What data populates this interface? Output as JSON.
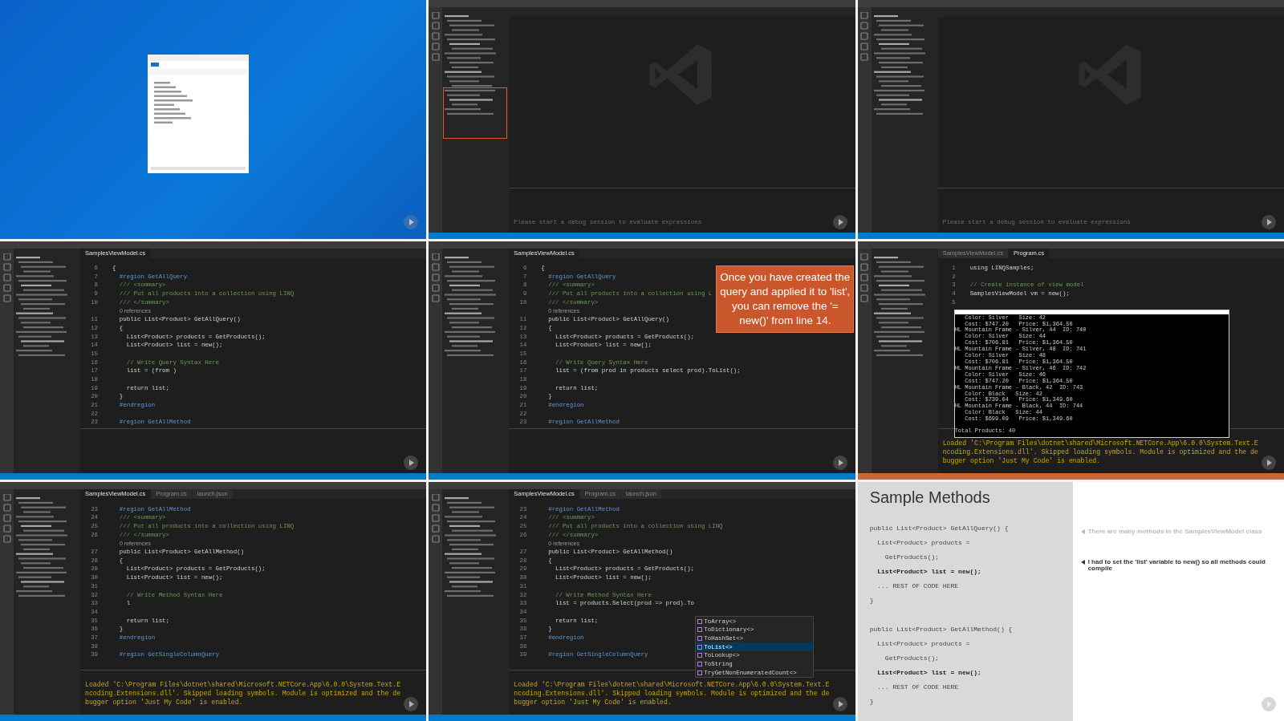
{
  "tiles": [
    {
      "kind": "desktop"
    },
    {
      "kind": "vscode",
      "welcome": true,
      "debugging": false,
      "sidebar_highlight": true,
      "panel_text": "Please start a debug session to evaluate expressions"
    },
    {
      "kind": "vscode",
      "welcome": true,
      "debugging": false,
      "panel_text": "Please start a debug session to evaluate expressions"
    },
    {
      "kind": "vscode",
      "debugging": false,
      "tabs": [
        {
          "label": "SamplesViewModel.cs",
          "selected": true
        }
      ],
      "lines": [
        {
          "num": "6",
          "text": "{",
          "kind": "code"
        },
        {
          "num": "7",
          "text": "  #region GetAllQuery",
          "kind": "region"
        },
        {
          "num": "8",
          "text": "  /// <summary>",
          "kind": "doc"
        },
        {
          "num": "9",
          "text": "  /// Put all products into a collection using LINQ",
          "kind": "doc"
        },
        {
          "num": "10",
          "text": "  /// </summary>",
          "kind": "doc"
        },
        {
          "text": "0 references",
          "kind": "refs"
        },
        {
          "num": "11",
          "text": "  public List<Product> GetAllQuery()",
          "kind": "code"
        },
        {
          "num": "12",
          "text": "  {",
          "kind": "code"
        },
        {
          "num": "13",
          "text": "    List<Product> products = GetProducts();",
          "kind": "code"
        },
        {
          "num": "14",
          "text": "    List<Product> list = new();",
          "kind": "code"
        },
        {
          "num": "15"
        },
        {
          "num": "16",
          "text": "    // Write Query Syntax Here",
          "kind": "comment"
        },
        {
          "num": "17",
          "text": "    list = (from )",
          "kind": "code"
        },
        {
          "num": "18"
        },
        {
          "num": "19",
          "text": "    return list;",
          "kind": "code"
        },
        {
          "num": "20",
          "text": "  }",
          "kind": "code"
        },
        {
          "num": "21",
          "text": "  #endregion",
          "kind": "region"
        },
        {
          "num": "22"
        },
        {
          "num": "23",
          "text": "  #region GetAllMethod",
          "kind": "region"
        }
      ]
    },
    {
      "kind": "vscode",
      "debugging": false,
      "tabs": [
        {
          "label": "SamplesViewModel.cs",
          "selected": true
        }
      ],
      "overlay_note": "Once you have created the query and applied it to 'list', you can remove the '= new()' from line 14.",
      "lines": [
        {
          "num": "6",
          "text": "{",
          "kind": "code"
        },
        {
          "num": "7",
          "text": "  #region GetAllQuery",
          "kind": "region"
        },
        {
          "num": "8",
          "text": "  /// <summary>",
          "kind": "doc"
        },
        {
          "num": "9",
          "text": "  /// Put all products into a collection using L",
          "kind": "doc"
        },
        {
          "num": "10",
          "text": "  /// </summary>",
          "kind": "doc"
        },
        {
          "text": "0 references",
          "kind": "refs"
        },
        {
          "num": "11",
          "text": "  public List<Product> GetAllQuery()",
          "kind": "code"
        },
        {
          "num": "12",
          "text": "  {",
          "kind": "code"
        },
        {
          "num": "13",
          "text": "    List<Product> products = GetProducts();",
          "kind": "code"
        },
        {
          "num": "14",
          "text": "    List<Product> list = new();",
          "kind": "code"
        },
        {
          "num": "15"
        },
        {
          "num": "16",
          "text": "    // Write Query Syntax Here",
          "kind": "comment"
        },
        {
          "num": "17",
          "text": "    list = (from prod in products select prod).ToList();",
          "kind": "code"
        },
        {
          "num": "18"
        },
        {
          "num": "19",
          "text": "    return list;",
          "kind": "code"
        },
        {
          "num": "20",
          "text": "  }",
          "kind": "code"
        },
        {
          "num": "21",
          "text": "  #endregion",
          "kind": "region"
        },
        {
          "num": "22"
        },
        {
          "num": "23",
          "text": "  #region GetAllMethod",
          "kind": "region"
        }
      ]
    },
    {
      "kind": "vscode",
      "debugging": true,
      "tabs": [
        {
          "label": "SamplesViewModel.cs",
          "selected": false
        },
        {
          "label": "Program.cs",
          "selected": true
        }
      ],
      "lines": [
        {
          "num": "1",
          "text": "using LINQSamples;",
          "kind": "code"
        },
        {
          "num": "2"
        },
        {
          "num": "3",
          "text": "// Create instance of view model",
          "kind": "comment"
        },
        {
          "num": "4",
          "text": "SamplesViewModel vm = new();",
          "kind": "code"
        },
        {
          "num": "5"
        }
      ],
      "console_window": {
        "lines": [
          "   Color: Silver   Size: 42",
          "   Cost: $747.20   Price: $1,364.50",
          "HL Mountain Frame - Silver, 44  ID: 740",
          "   Color: Silver   Size: 44",
          "   Cost: $706.81   Price: $1,364.50",
          "HL Mountain Frame - Silver, 48  ID: 741",
          "   Color: Silver   Size: 48",
          "   Cost: $706.81   Price: $1,364.50",
          "HL Mountain Frame - Silver, 46  ID: 742",
          "   Color: Silver   Size: 46",
          "   Cost: $747.20   Price: $1,364.50",
          "HL Mountain Frame - Black, 42  ID: 743",
          "   Color: Black   Size: 42",
          "   Cost: $739.04   Price: $1,349.60",
          "HL Mountain Frame - Black, 44  ID: 744",
          "   Color: Black   Size: 44",
          "   Cost: $699.09   Price: $1,349.60"
        ],
        "total": "Total Products: 40"
      },
      "panel_text": "Loaded 'C:\\Program Files\\dotnet\\shared\\Microsoft.NETCore.App\\6.0.0\\System.Text.Encoding.Extensions.dll'. Skipped loading symbols. Module is optimized and the debugger option 'Just My Code' is enabled."
    },
    {
      "kind": "vscode",
      "debugging": false,
      "tabs": [
        {
          "label": "SamplesViewModel.cs",
          "selected": true
        },
        {
          "label": "Program.cs",
          "selected": false
        },
        {
          "label": "launch.json",
          "selected": false
        }
      ],
      "lines": [
        {
          "num": "23",
          "text": "  #region GetAllMethod",
          "kind": "region"
        },
        {
          "num": "24",
          "text": "  /// <summary>",
          "kind": "doc"
        },
        {
          "num": "25",
          "text": "  /// Put all products into a collection using LINQ",
          "kind": "doc"
        },
        {
          "num": "26",
          "text": "  /// </summary>",
          "kind": "doc"
        },
        {
          "text": "0 references",
          "kind": "refs"
        },
        {
          "num": "27",
          "text": "  public List<Product> GetAllMethod()",
          "kind": "code"
        },
        {
          "num": "28",
          "text": "  {",
          "kind": "code"
        },
        {
          "num": "29",
          "text": "    List<Product> products = GetProducts();",
          "kind": "code"
        },
        {
          "num": "30",
          "text": "    List<Product> list = new();",
          "kind": "code"
        },
        {
          "num": "31"
        },
        {
          "num": "32",
          "text": "    // Write Method Syntax Here",
          "kind": "comment"
        },
        {
          "num": "33",
          "text": "    l",
          "kind": "code"
        },
        {
          "num": "34"
        },
        {
          "num": "35",
          "text": "    return list;",
          "kind": "code"
        },
        {
          "num": "36",
          "text": "  }",
          "kind": "code"
        },
        {
          "num": "37",
          "text": "  #endregion",
          "kind": "region"
        },
        {
          "num": "38"
        },
        {
          "num": "39",
          "text": "  #region GetSingleColumnQuery",
          "kind": "region"
        }
      ],
      "panel_text": "Loaded 'C:\\Program Files\\dotnet\\shared\\Microsoft.NETCore.App\\6.0.0\\System.Text.Encoding.Extensions.dll'. Skipped loading symbols. Module is optimized and the debugger option 'Just My Code' is enabled."
    },
    {
      "kind": "vscode",
      "debugging": false,
      "tabs": [
        {
          "label": "SamplesViewModel.cs",
          "selected": true
        },
        {
          "label": "Program.cs",
          "selected": false
        },
        {
          "label": "launch.json",
          "selected": false
        }
      ],
      "lines": [
        {
          "num": "23",
          "text": "  #region GetAllMethod",
          "kind": "region"
        },
        {
          "num": "24",
          "text": "  /// <summary>",
          "kind": "doc"
        },
        {
          "num": "25",
          "text": "  /// Put all products into a collection using LINQ",
          "kind": "doc"
        },
        {
          "num": "26",
          "text": "  /// </summary>",
          "kind": "doc"
        },
        {
          "text": "0 references",
          "kind": "refs"
        },
        {
          "num": "27",
          "text": "  public List<Product> GetAllMethod()",
          "kind": "code"
        },
        {
          "num": "28",
          "text": "  {",
          "kind": "code"
        },
        {
          "num": "29",
          "text": "    List<Product> products = GetProducts();",
          "kind": "code"
        },
        {
          "num": "30",
          "text": "    List<Product> list = new();",
          "kind": "code"
        },
        {
          "num": "31"
        },
        {
          "num": "32",
          "text": "    // Write Method Syntax Here",
          "kind": "comment"
        },
        {
          "num": "33",
          "text": "    list = products.Select(prod => prod).To",
          "kind": "code"
        },
        {
          "num": "34"
        },
        {
          "num": "35",
          "text": "    return list;",
          "kind": "code"
        },
        {
          "num": "36",
          "text": "  }",
          "kind": "code"
        },
        {
          "num": "37",
          "text": "  #endregion",
          "kind": "region"
        },
        {
          "num": "38"
        },
        {
          "num": "39",
          "text": "  #region GetSingleColumnQuery",
          "kind": "region"
        }
      ],
      "suggestions": [
        {
          "label": "ToArray<>",
          "selected": false
        },
        {
          "label": "ToDictionary<>",
          "selected": false
        },
        {
          "label": "ToHashSet<>",
          "selected": false
        },
        {
          "label": "ToList<>",
          "selected": true
        },
        {
          "label": "ToLookup<>",
          "selected": false
        },
        {
          "label": "ToString",
          "selected": false
        },
        {
          "label": "TryGetNonEnumeratedCount<>",
          "selected": false
        }
      ],
      "panel_text": "Loaded 'C:\\Program Files\\dotnet\\shared\\Microsoft.NETCore.App\\6.0.0\\System.Text.Encoding.Extensions.dll'. Skipped loading symbols. Module is optimized and the debugger option 'Just My Code' is enabled."
    },
    {
      "kind": "slide",
      "title": "Sample Methods",
      "code_blocks": [
        [
          {
            "text": "public List<Product> GetAllQuery() {",
            "bold": false
          },
          {
            "text": "  List<Product> products =",
            "bold": false
          },
          {
            "text": "    GetProducts();",
            "bold": false
          },
          {
            "text": "  List<Product> list = new();",
            "bold": true
          },
          {
            "text": "  ... REST OF CODE HERE",
            "bold": false
          },
          {
            "text": "}",
            "bold": false
          }
        ],
        [
          {
            "text": "public List<Product> GetAllMethod() {",
            "bold": false
          },
          {
            "text": "  List<Product> products =",
            "bold": false
          },
          {
            "text": "    GetProducts();",
            "bold": false
          },
          {
            "text": "  List<Product> list = new();",
            "bold": true
          },
          {
            "text": "  ... REST OF CODE HERE",
            "bold": false
          },
          {
            "text": "}",
            "bold": false
          }
        ]
      ],
      "bullets": [
        {
          "text": "There are many methods in the SamplesViewModel class",
          "dimmed": true
        },
        {
          "text": "I had to set the 'list' variable to new() so all methods could compile",
          "dimmed": false
        }
      ]
    }
  ]
}
